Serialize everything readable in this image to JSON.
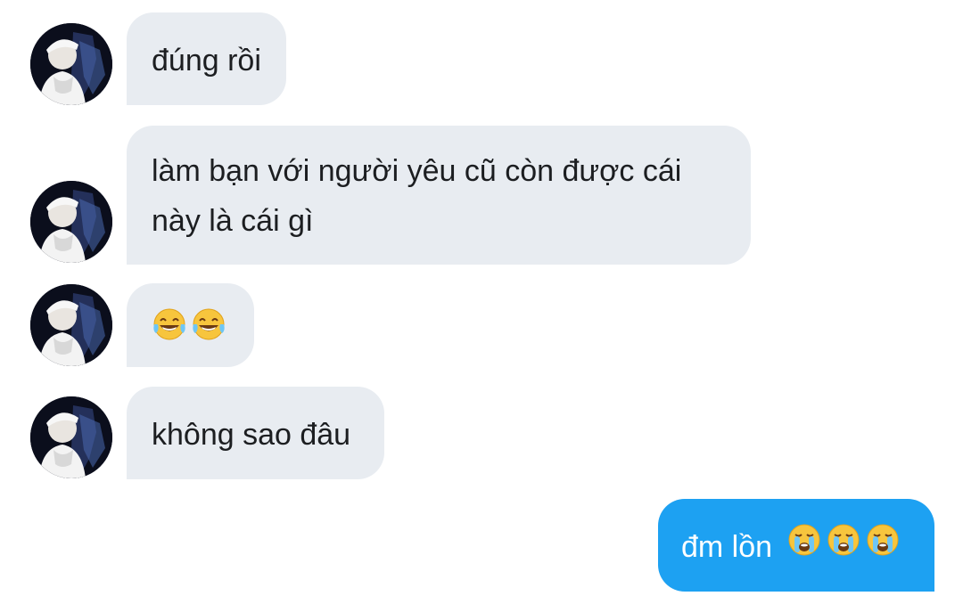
{
  "conversation": {
    "messages": [
      {
        "from": "other",
        "text": "đúng rồi"
      },
      {
        "from": "other",
        "line1": "làm bạn với người yêu cũ còn được cái",
        "line2": "này là cái gì"
      },
      {
        "from": "other",
        "emojis": [
          "face-with-tears-of-joy-icon",
          "face-with-tears-of-joy-icon"
        ]
      },
      {
        "from": "other",
        "text": "không sao đâu"
      },
      {
        "from": "me",
        "text": "đm lồn",
        "emojis": [
          "loudly-crying-face-icon",
          "loudly-crying-face-icon",
          "loudly-crying-face-icon"
        ]
      }
    ]
  },
  "colors": {
    "incoming_bubble": "#e8ecf1",
    "outgoing_bubble": "#1da1f2",
    "incoming_text": "#1c1e21",
    "outgoing_text": "#ffffff"
  }
}
